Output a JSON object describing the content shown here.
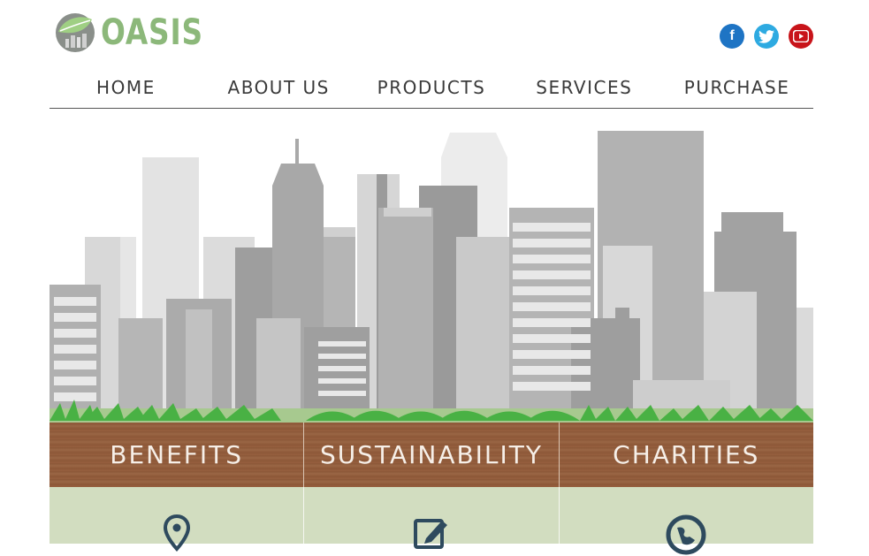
{
  "brand": {
    "name": "OASIS",
    "logo_icon": "leaf-globe-icon",
    "color": "#8cb87a"
  },
  "social": [
    {
      "name": "facebook",
      "icon": "facebook-icon",
      "glyph": "f",
      "color": "#1e74c4"
    },
    {
      "name": "twitter",
      "icon": "twitter-icon",
      "color": "#2eaae1"
    },
    {
      "name": "youtube",
      "icon": "youtube-icon",
      "color": "#c8141a"
    }
  ],
  "nav": [
    "HOME",
    "ABOUT US",
    "PRODUCTS",
    "SERVICES",
    "PURCHASE"
  ],
  "hero": {
    "illustration": "city-skyline-with-grass"
  },
  "sections": [
    {
      "label": "BENEFITS",
      "icon": "location-pin-icon"
    },
    {
      "label": "SUSTAINABILITY",
      "icon": "edit-note-icon"
    },
    {
      "label": "CHARITIES",
      "icon": "globe-icon"
    }
  ],
  "colors": {
    "wood": "#8d5838",
    "panel": "#d2ddc0",
    "icon": "#2e4a5e",
    "nav_text": "#3a3a3a"
  }
}
